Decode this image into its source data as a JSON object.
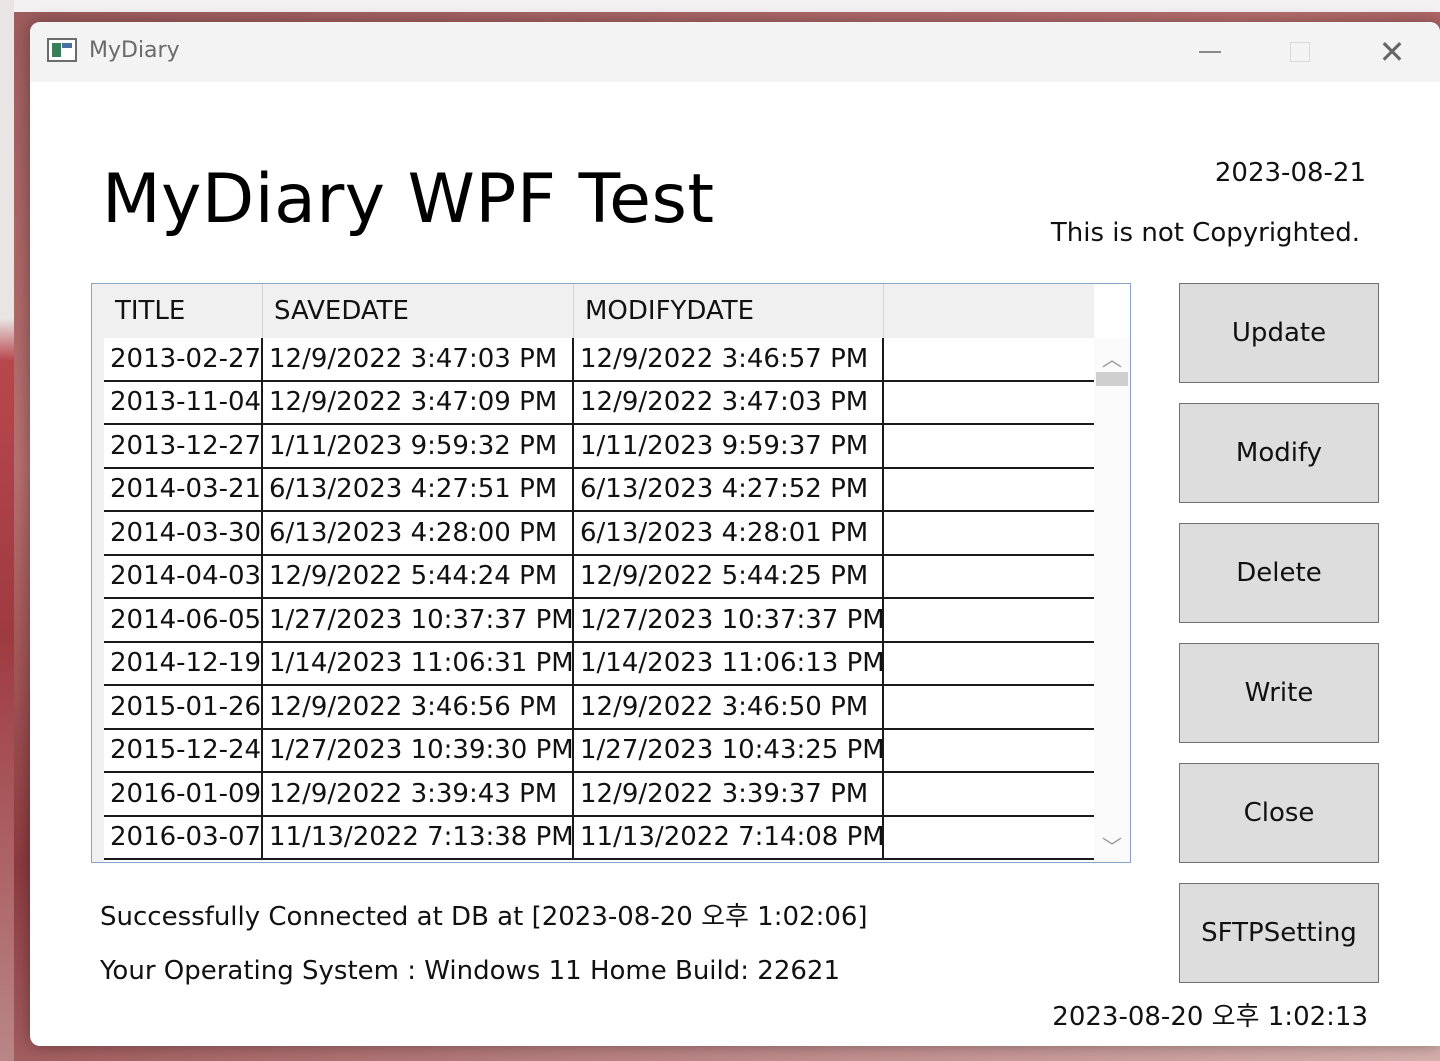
{
  "window": {
    "title": "MyDiary"
  },
  "header": {
    "title": "MyDiary WPF Test",
    "date": "2023-08-21",
    "copyright": "This is not Copyrighted."
  },
  "grid": {
    "columns": [
      "TITLE",
      "SAVEDATE",
      "MODIFYDATE"
    ],
    "rows": [
      [
        "2013-02-27",
        "12/9/2022 3:47:03 PM",
        "12/9/2022 3:46:57 PM"
      ],
      [
        "2013-11-04",
        "12/9/2022 3:47:09 PM",
        "12/9/2022 3:47:03 PM"
      ],
      [
        "2013-12-27",
        "1/11/2023 9:59:32 PM",
        "1/11/2023 9:59:37 PM"
      ],
      [
        "2014-03-21",
        "6/13/2023 4:27:51 PM",
        "6/13/2023 4:27:52 PM"
      ],
      [
        "2014-03-30",
        "6/13/2023 4:28:00 PM",
        "6/13/2023 4:28:01 PM"
      ],
      [
        "2014-04-03",
        "12/9/2022 5:44:24 PM",
        "12/9/2022 5:44:25 PM"
      ],
      [
        "2014-06-05",
        "1/27/2023 10:37:37 PM",
        "1/27/2023 10:37:37 PM"
      ],
      [
        "2014-12-19",
        "1/14/2023 11:06:31 PM",
        "1/14/2023 11:06:13 PM"
      ],
      [
        "2015-01-26",
        "12/9/2022 3:46:56 PM",
        "12/9/2022 3:46:50 PM"
      ],
      [
        "2015-12-24",
        "1/27/2023 10:39:30 PM",
        "1/27/2023 10:43:25 PM"
      ],
      [
        "2016-01-09",
        "12/9/2022 3:39:43 PM",
        "12/9/2022 3:39:37 PM"
      ],
      [
        "2016-03-07",
        "11/13/2022 7:13:38 PM",
        "11/13/2022 7:14:08 PM"
      ]
    ]
  },
  "buttons": {
    "update": "Update",
    "modify": "Modify",
    "delete": "Delete",
    "write": "Write",
    "close": "Close",
    "sftp": "SFTPSetting"
  },
  "status": {
    "db": "Successfully Connected at DB at [2023-08-20 오후 1:02:06]",
    "os": "Your Operating System : Windows 11 Home Build: 22621",
    "clock": "2023-08-20 오후 1:02:13"
  },
  "icons": {
    "app": "app-window-icon",
    "minimize": "minimize-icon",
    "maximize": "maximize-icon",
    "close": "close-icon",
    "scroll_up": "chevron-up-icon",
    "scroll_down": "chevron-down-icon"
  }
}
